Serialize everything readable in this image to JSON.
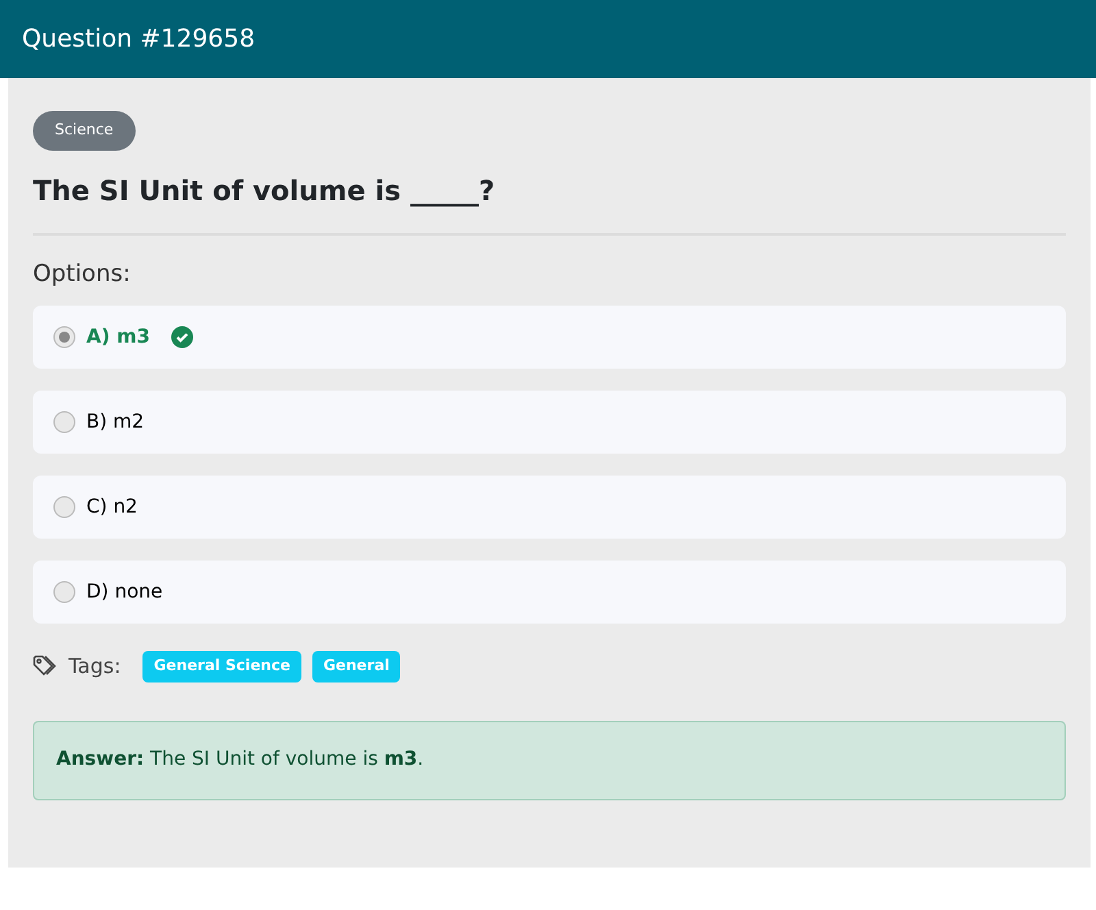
{
  "header": {
    "title": "Question #129658"
  },
  "category": "Science",
  "question": "The SI Unit of volume is _____?",
  "options_label": "Options:",
  "options": [
    {
      "label": "A) m3",
      "selected": true,
      "correct": true
    },
    {
      "label": "B) m2",
      "selected": false,
      "correct": false
    },
    {
      "label": "C) n2",
      "selected": false,
      "correct": false
    },
    {
      "label": "D) none",
      "selected": false,
      "correct": false
    }
  ],
  "tags_label": "Tags:",
  "tags": [
    "General Science",
    "General"
  ],
  "answer": "**Answer:** The SI Unit of volume is **m3**."
}
